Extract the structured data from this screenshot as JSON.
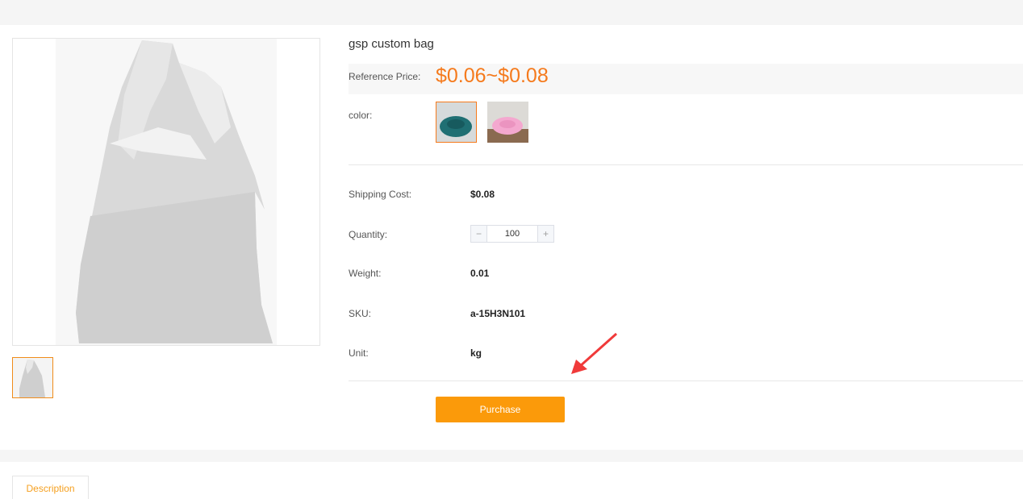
{
  "product": {
    "title": "gsp custom bag",
    "price_label": "Reference Price:",
    "price_value": "$0.06~$0.08",
    "color_label": "color:",
    "colors": [
      {
        "name": "teal",
        "selected": true,
        "hex": "#1f6f73"
      },
      {
        "name": "pink",
        "selected": false,
        "hex": "#f4a8cf"
      }
    ]
  },
  "details": {
    "shipping_label": "Shipping Cost:",
    "shipping_value": "$0.08",
    "quantity_label": "Quantity:",
    "quantity_value": "100",
    "minus": "−",
    "plus": "+",
    "weight_label": "Weight:",
    "weight_value": "0.01",
    "sku_label": "SKU:",
    "sku_value": "a-15H3N101",
    "unit_label": "Unit:",
    "unit_value": "kg"
  },
  "actions": {
    "purchase_label": "Purchase"
  },
  "tabs": {
    "description_label": "Description"
  },
  "colors": {
    "accent": "#f57a1c",
    "button": "#fb9a0a",
    "arrow": "#f03a3a"
  }
}
